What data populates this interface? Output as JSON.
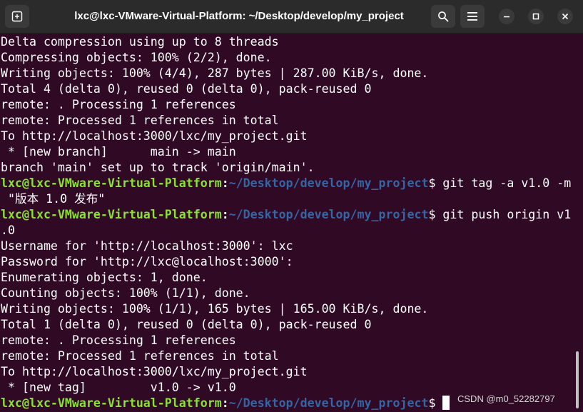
{
  "window": {
    "title": "lxc@lxc-VMware-Virtual-Platform: ~/Desktop/develop/my_project"
  },
  "titlebar": {
    "new_tab_icon": "new-tab-icon",
    "search_icon": "search-icon",
    "menu_icon": "hamburger-menu-icon",
    "minimize_icon": "minimize-icon",
    "maximize_icon": "maximize-icon",
    "close_icon": "close-icon"
  },
  "prompt": {
    "user_host": "lxc@lxc-VMware-Virtual-Platform",
    "colon": ":",
    "path": "~/Desktop/develop/my_project",
    "dollar": "$ "
  },
  "terminal": {
    "line0": "Delta compression using up to 8 threads",
    "line1": "Compressing objects: 100% (2/2), done.",
    "line2": "Writing objects: 100% (4/4), 287 bytes | 287.00 KiB/s, done.",
    "line3": "Total 4 (delta 0), reused 0 (delta 0), pack-reused 0",
    "line4": "remote: . Processing 1 references",
    "line5": "remote: Processed 1 references in total",
    "line6": "To http://localhost:3000/lxc/my_project.git",
    "line7": " * [new branch]      main -> main",
    "line8": "branch 'main' set up to track 'origin/main'.",
    "cmd1": "git tag -a v1.0 -m",
    "line10": " \"版本 1.0 发布\"",
    "cmd2": "git push origin v1",
    "line12": ".0",
    "line13": "Username for 'http://localhost:3000': lxc",
    "line14": "Password for 'http://lxc@localhost:3000':",
    "line15": "Enumerating objects: 1, done.",
    "line16": "Counting objects: 100% (1/1), done.",
    "line17": "Writing objects: 100% (1/1), 165 bytes | 165.00 KiB/s, done.",
    "line18": "Total 1 (delta 0), reused 0 (delta 0), pack-reused 0",
    "line19": "remote: . Processing 1 references",
    "line20": "remote: Processed 1 references in total",
    "line21": "To http://localhost:3000/lxc/my_project.git",
    "line22": " * [new tag]         v1.0 -> v1.0"
  },
  "watermark": "CSDN @m0_52282797",
  "colors": {
    "background": "#300a24",
    "prompt_user": "#8ae234",
    "prompt_path": "#3465a4",
    "titlebar": "#2b2b2b"
  }
}
